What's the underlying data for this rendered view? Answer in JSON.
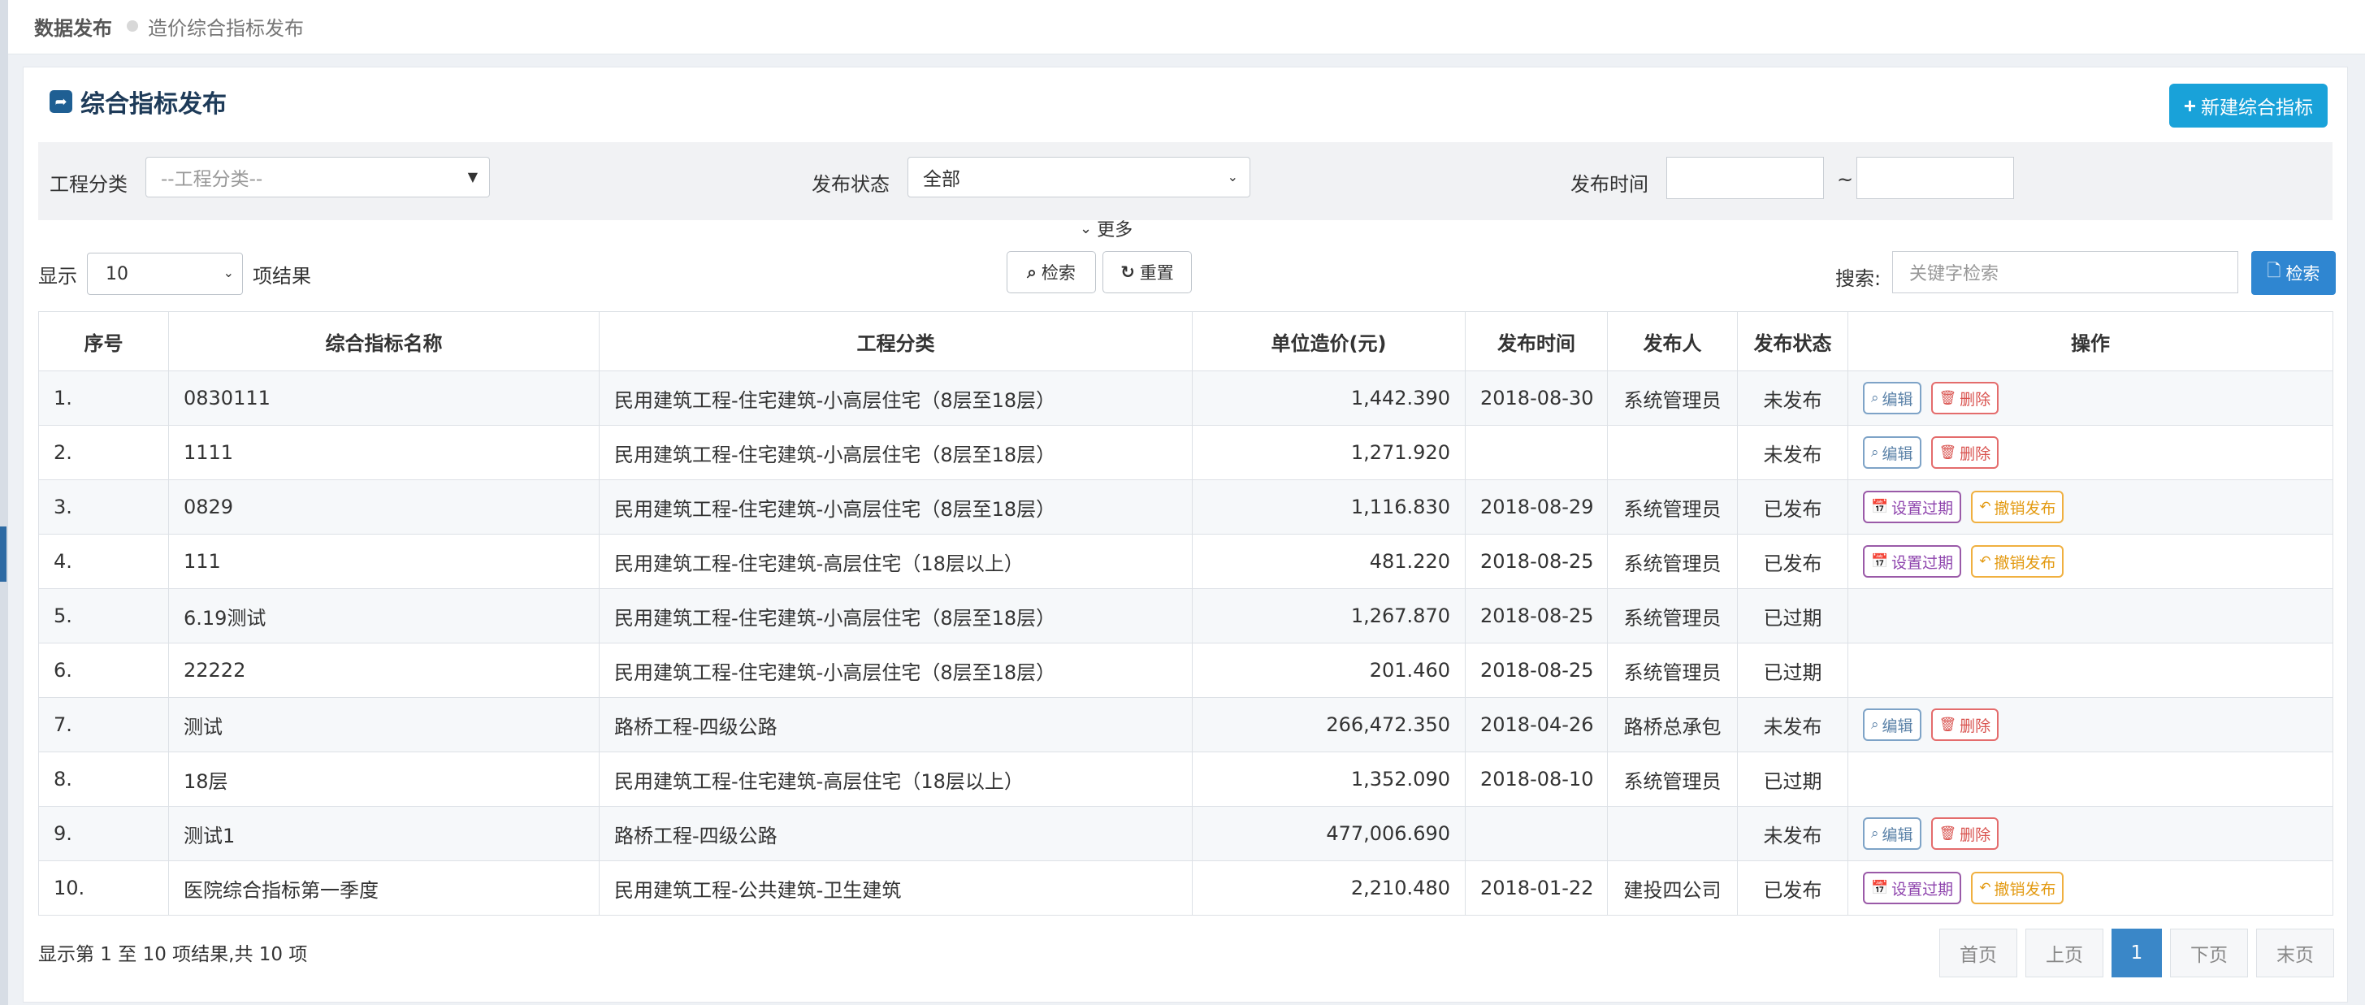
{
  "breadcrumb": {
    "home": "数据发布",
    "current": "造价综合指标发布"
  },
  "header": {
    "title": "综合指标发布",
    "new_button": "新建综合指标"
  },
  "filters": {
    "category_label": "工程分类",
    "category_placeholder": "--工程分类--",
    "status_label": "发布状态",
    "status_value": "全部",
    "time_label": "发布时间",
    "time_sep": "~",
    "more_label": "更多"
  },
  "toolbar": {
    "show_label": "显示",
    "page_length": "10",
    "results_label": "项结果",
    "search_btn": "检索",
    "reset_btn": "重置",
    "search_label": "搜索:",
    "search_placeholder": "关键字检索",
    "search_submit": "检索"
  },
  "table": {
    "columns": [
      "序号",
      "综合指标名称",
      "工程分类",
      "单位造价(元)",
      "发布时间",
      "发布人",
      "发布状态",
      "操作"
    ],
    "rows": [
      {
        "no": "1.",
        "name": "0830111",
        "category": "民用建筑工程-住宅建筑-小高层住宅（8层至18层）",
        "price": "1,442.390",
        "date": "2018-08-30",
        "publisher": "系统管理员",
        "status": "未发布",
        "actions": [
          "编辑",
          "删除"
        ]
      },
      {
        "no": "2.",
        "name": "1111",
        "category": "民用建筑工程-住宅建筑-小高层住宅（8层至18层）",
        "price": "1,271.920",
        "date": "",
        "publisher": "",
        "status": "未发布",
        "actions": [
          "编辑",
          "删除"
        ]
      },
      {
        "no": "3.",
        "name": "0829",
        "category": "民用建筑工程-住宅建筑-小高层住宅（8层至18层）",
        "price": "1,116.830",
        "date": "2018-08-29",
        "publisher": "系统管理员",
        "status": "已发布",
        "actions": [
          "设置过期",
          "撤销发布"
        ]
      },
      {
        "no": "4.",
        "name": "111",
        "category": "民用建筑工程-住宅建筑-高层住宅（18层以上）",
        "price": "481.220",
        "date": "2018-08-25",
        "publisher": "系统管理员",
        "status": "已发布",
        "actions": [
          "设置过期",
          "撤销发布"
        ]
      },
      {
        "no": "5.",
        "name": "6.19测试",
        "category": "民用建筑工程-住宅建筑-小高层住宅（8层至18层）",
        "price": "1,267.870",
        "date": "2018-08-25",
        "publisher": "系统管理员",
        "status": "已过期",
        "actions": []
      },
      {
        "no": "6.",
        "name": "22222",
        "category": "民用建筑工程-住宅建筑-小高层住宅（8层至18层）",
        "price": "201.460",
        "date": "2018-08-25",
        "publisher": "系统管理员",
        "status": "已过期",
        "actions": []
      },
      {
        "no": "7.",
        "name": "测试",
        "category": "路桥工程-四级公路",
        "price": "266,472.350",
        "date": "2018-04-26",
        "publisher": "路桥总承包",
        "status": "未发布",
        "actions": [
          "编辑",
          "删除"
        ]
      },
      {
        "no": "8.",
        "name": "18层",
        "category": "民用建筑工程-住宅建筑-高层住宅（18层以上）",
        "price": "1,352.090",
        "date": "2018-08-10",
        "publisher": "系统管理员",
        "status": "已过期",
        "actions": []
      },
      {
        "no": "9.",
        "name": "测试1",
        "category": "路桥工程-四级公路",
        "price": "477,006.690",
        "date": "",
        "publisher": "",
        "status": "未发布",
        "actions": [
          "编辑",
          "删除"
        ]
      },
      {
        "no": "10.",
        "name": "医院综合指标第一季度",
        "category": "民用建筑工程-公共建筑-卫生建筑",
        "price": "2,210.480",
        "date": "2018-01-22",
        "publisher": "建投四公司",
        "status": "已发布",
        "actions": [
          "设置过期",
          "撤销发布"
        ]
      }
    ]
  },
  "footer": {
    "info": "显示第 1 至 10 项结果,共 10 项",
    "pager": {
      "first": "首页",
      "prev": "上页",
      "current": "1",
      "next": "下页",
      "last": "末页"
    }
  },
  "colors": {
    "primary": "#19a2d9",
    "search_btn": "#2f86d1",
    "pager_active": "#3a87c8",
    "edit": "#5b82a8",
    "delete": "#d9534f",
    "expire": "#8e44ad",
    "revoke": "#e39a12"
  }
}
